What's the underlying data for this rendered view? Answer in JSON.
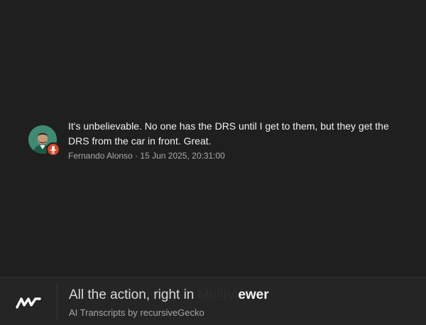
{
  "message": {
    "text": "It's unbelievable. No one has the DRS until I get to them, but they get the DRS from the car in front. Great.",
    "speaker": "Fernando Alonso",
    "separator": "·",
    "timestamp": "15 Jun 2025, 20:31:00",
    "avatar_icon": "driver-avatar",
    "badge_icon": "microphone-icon",
    "badge_color": "#d4452a"
  },
  "footer": {
    "logo_icon": "mv-logo-icon",
    "title_visible": "All the action, right in",
    "title_faded": "MultiVi",
    "title_tail": "ewer",
    "subtitle": "AI Transcripts by recursiveGecko"
  },
  "colors": {
    "background": "#1f1f1f",
    "footer_background": "#252525",
    "text": "#f2f2f2",
    "muted": "#a9a9a9"
  }
}
